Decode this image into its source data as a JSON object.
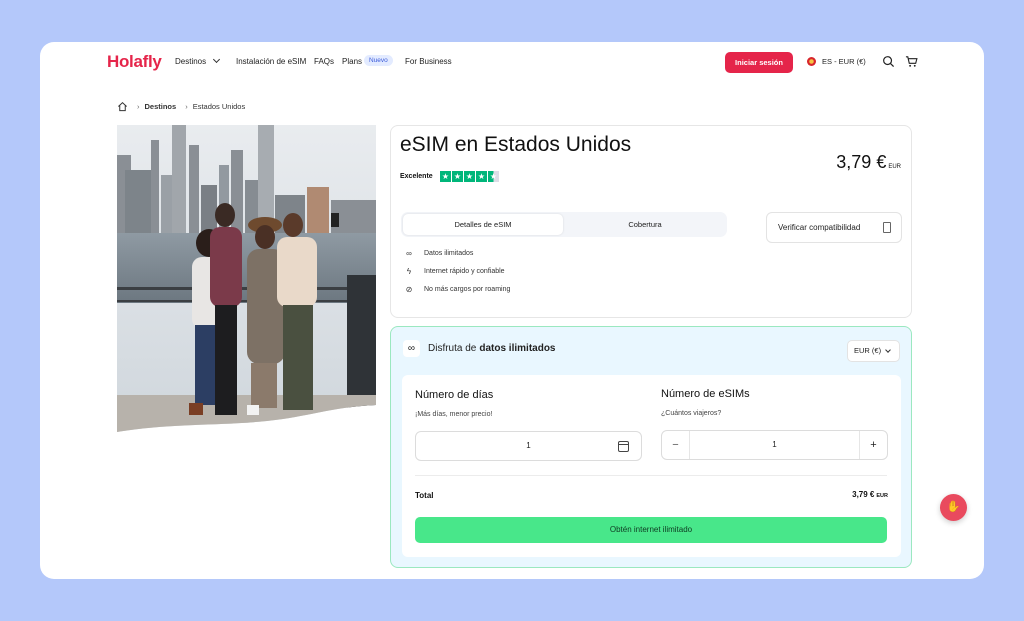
{
  "nav": {
    "logo": "Holafly",
    "links": {
      "destinations": "Destinos",
      "install": "Instalación de eSIM",
      "faqs": "FAQs",
      "plans": "Plans",
      "plans_badge": "Nuevo",
      "business": "For Business"
    },
    "login_label": "Iniciar sesión",
    "language_currency": "ES - EUR (€)",
    "icons": [
      "home-icon",
      "search-icon",
      "cart-icon"
    ]
  },
  "breadcrumb": [
    "Destinos",
    "Estados Unidos"
  ],
  "product": {
    "title": "eSIM en Estados Unidos",
    "rating_label": "Excelente",
    "rating_stars": 4.5,
    "price": "3,79 €",
    "price_currency": "EUR",
    "tabs": [
      "Detalles de eSIM",
      "Cobertura"
    ],
    "verify_label": "Verificar compatibilidad",
    "features": [
      "Datos ilimitados",
      "Internet rápido y confiable",
      "No más cargos por roaming"
    ]
  },
  "config": {
    "heading_prefix": "Disfruta de",
    "heading_bold": "datos ilimitados",
    "currency_select": "EUR (€)",
    "days": {
      "label": "Número de días",
      "sub": "¡Más días, menor precio!",
      "value": "1"
    },
    "esims": {
      "label": "Número de eSIMs",
      "sub": "¿Cuántos viajeros?",
      "value": "1",
      "minus": "−",
      "plus": "+"
    },
    "total_label": "Total",
    "total_value": "3,79 €",
    "total_currency": "EUR",
    "cta_label": "Obtén internet ilimitado"
  },
  "colors": {
    "page_bg": "#b4c8fa",
    "brand_red": "#e5254a",
    "cta_green": "#48e78a",
    "config_bg": "#e9f7ff",
    "trustpilot": "#00b67a"
  }
}
